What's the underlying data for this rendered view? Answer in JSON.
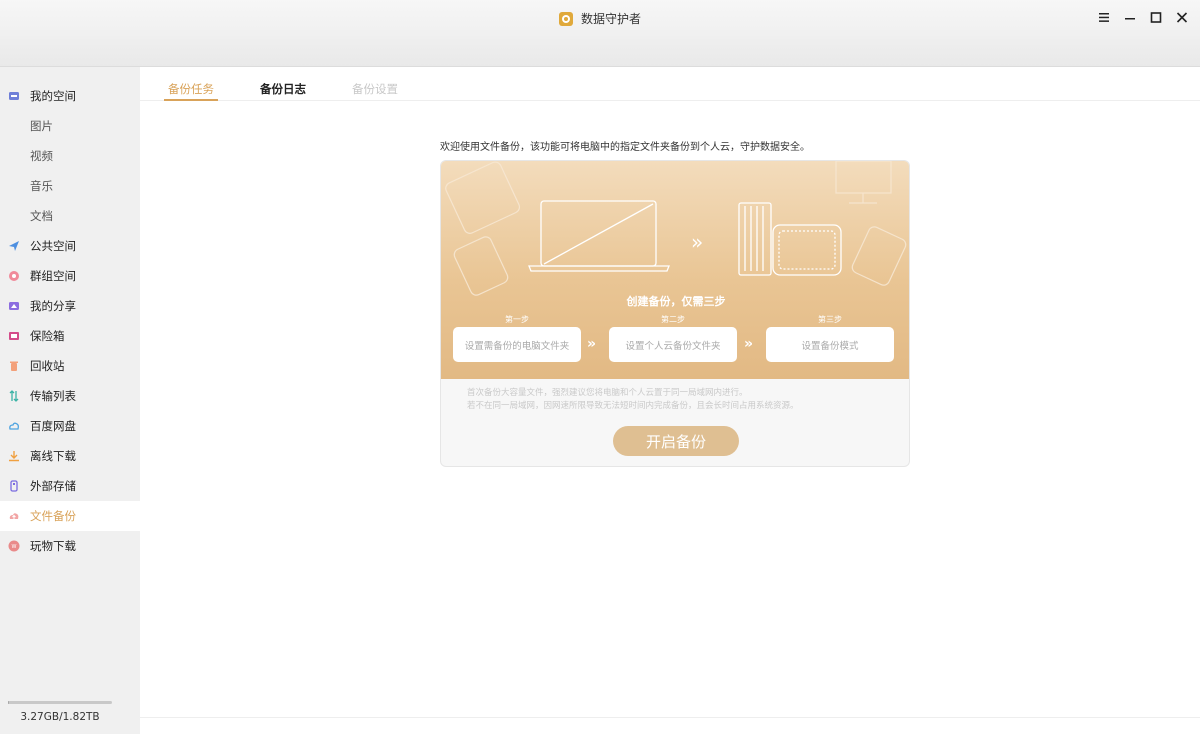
{
  "app": {
    "title": "数据守护者",
    "accent_color": "#d9a35a",
    "logo_icon": "app-logo-icon"
  },
  "window_controls": [
    {
      "name": "menu-icon"
    },
    {
      "name": "minimize-icon"
    },
    {
      "name": "maximize-icon"
    },
    {
      "name": "close-icon"
    }
  ],
  "sidebar": {
    "items": [
      {
        "label": "我的空间",
        "icon": "my-space-icon"
      },
      {
        "label": "图片"
      },
      {
        "label": "视频"
      },
      {
        "label": "音乐"
      },
      {
        "label": "文档"
      },
      {
        "label": "公共空间",
        "icon": "public-space-icon"
      },
      {
        "label": "群组空间",
        "icon": "group-space-icon"
      },
      {
        "label": "我的分享",
        "icon": "share-icon"
      },
      {
        "label": "保险箱",
        "icon": "safe-icon"
      },
      {
        "label": "回收站",
        "icon": "trash-icon"
      },
      {
        "label": "传输列表",
        "icon": "transfer-icon"
      },
      {
        "label": "百度网盘",
        "icon": "baidu-cloud-icon"
      },
      {
        "label": "离线下载",
        "icon": "offline-download-icon"
      },
      {
        "label": "外部存储",
        "icon": "external-storage-icon"
      },
      {
        "label": "文件备份",
        "icon": "file-backup-icon",
        "active": true
      },
      {
        "label": "玩物下载",
        "icon": "wanwu-download-icon"
      }
    ],
    "storage": {
      "text": "3.27GB/1.82TB",
      "used_fraction": 0.0018
    }
  },
  "tabs": [
    {
      "label": "备份任务",
      "active": true
    },
    {
      "label": "备份日志"
    },
    {
      "label": "备份设置",
      "disabled": true
    }
  ],
  "main": {
    "intro": "欢迎使用文件备份，该功能可将电脑中的指定文件夹备份到个人云，守护数据安全。",
    "steps_title": "创建备份，仅需三步",
    "steps": [
      {
        "label": "第一步",
        "text": "设置需备份的电脑文件夹"
      },
      {
        "label": "第二步",
        "text": "设置个人云备份文件夹"
      },
      {
        "label": "第三步",
        "text": "设置备份模式"
      }
    ],
    "notes": [
      "首次备份大容量文件，强烈建议您将电脑和个人云置于同一局域网内进行。",
      "若不在同一局域网，因网速所限导致无法短时间内完成备份，且会长时间占用系统资源。"
    ],
    "start_button": "开启备份"
  }
}
